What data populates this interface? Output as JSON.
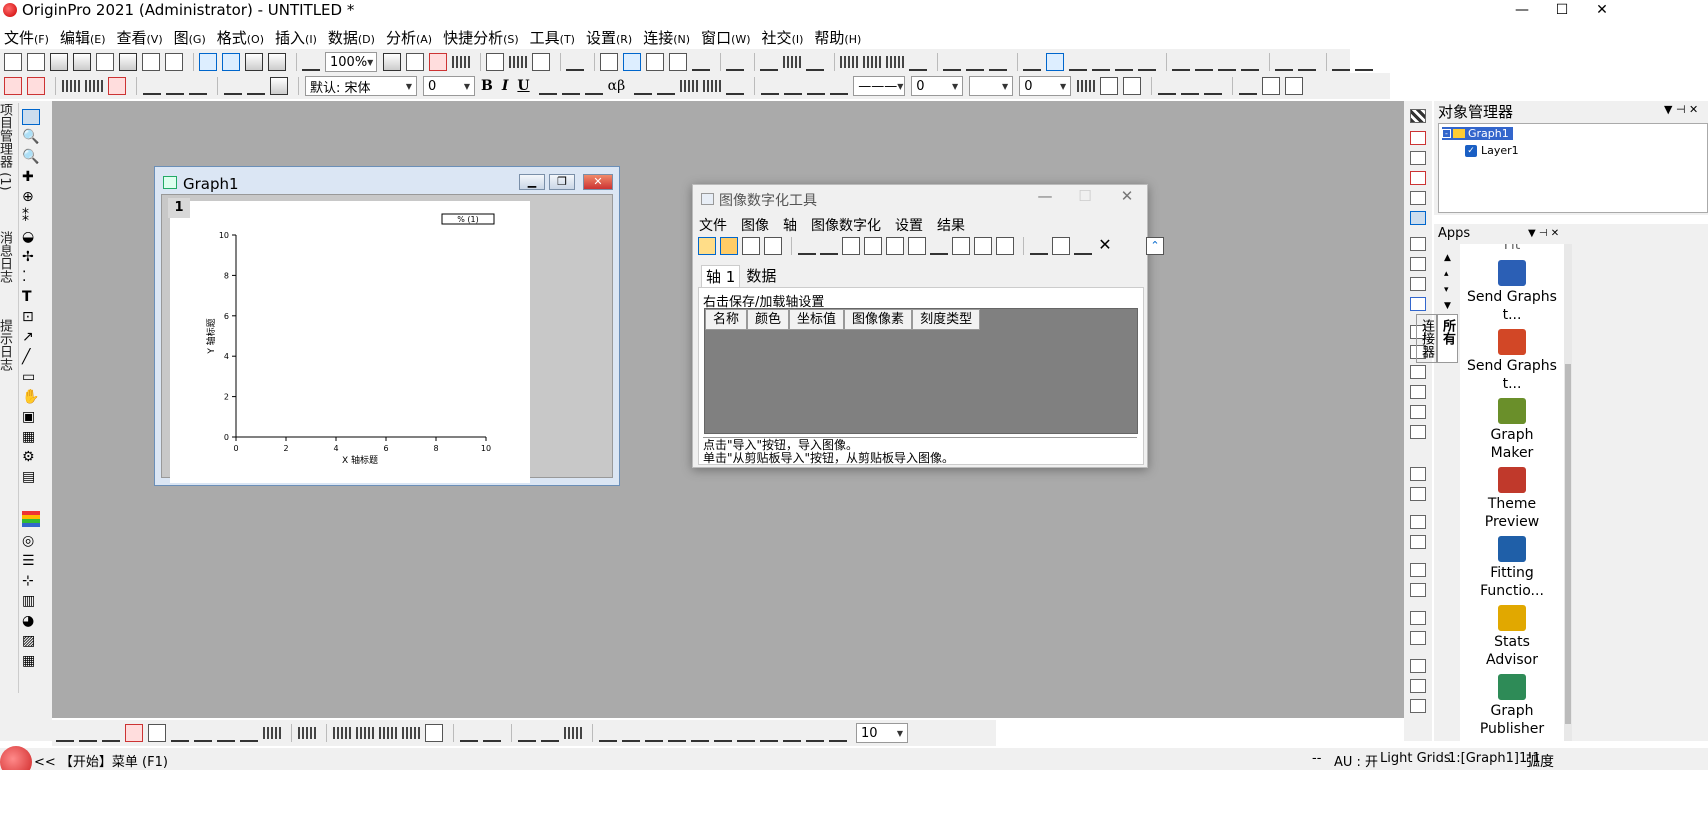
{
  "window": {
    "title": "OriginPro 2021 (Administrator) - UNTITLED *"
  },
  "menu": [
    {
      "label": "文件",
      "key": "(F)"
    },
    {
      "label": "编辑",
      "key": "(E)"
    },
    {
      "label": "查看",
      "key": "(V)"
    },
    {
      "label": "图",
      "key": "(G)"
    },
    {
      "label": "格式",
      "key": "(O)"
    },
    {
      "label": "插入",
      "key": "(I)"
    },
    {
      "label": "数据",
      "key": "(D)"
    },
    {
      "label": "分析",
      "key": "(A)"
    },
    {
      "label": "快捷分析",
      "key": "(S)"
    },
    {
      "label": "工具",
      "key": "(T)"
    },
    {
      "label": "设置",
      "key": "(R)"
    },
    {
      "label": "连接",
      "key": "(N)"
    },
    {
      "label": "窗口",
      "key": "(W)"
    },
    {
      "label": "社交",
      "key": "(I)"
    },
    {
      "label": "帮助",
      "key": "(H)"
    }
  ],
  "toolbar": {
    "zoom": "100%",
    "font": "默认: 宋体",
    "font_size": "0",
    "line_width": "0",
    "line_width2": "0",
    "bold": "B",
    "italic": "I",
    "underline": "U",
    "greek": "αβ"
  },
  "left_tabs": [
    "项目管理器 (1)",
    "消息日志",
    "提示日志"
  ],
  "graph_window": {
    "title": "Graph1",
    "layer_badge": "1",
    "legend_text": "% (1)",
    "xlabel": "X 轴标题",
    "ylabel": "Y 轴标题",
    "xticks": [
      "0",
      "2",
      "4",
      "6",
      "8",
      "10"
    ],
    "yticks": [
      "0",
      "2",
      "4",
      "6",
      "8",
      "10"
    ]
  },
  "digitizer": {
    "title": "图像数字化工具",
    "menu": [
      "文件",
      "图像",
      "轴",
      "图像数字化",
      "设置",
      "结果"
    ],
    "tabs": [
      "轴 1",
      "数据"
    ],
    "hint": "右击保存/加载轴设置",
    "columns": [
      "名称",
      "颜色",
      "坐标值",
      "图像像素",
      "刻度类型"
    ],
    "status_line1": "点击\"导入\"按钮，导入图像。",
    "status_line2": "单击\"从剪贴板导入\"按钮，从剪贴板导入图像。"
  },
  "object_manager": {
    "title": "对象管理器",
    "graph_node": "Graph1",
    "layer_node": "Layer1"
  },
  "apps": {
    "title": "Apps",
    "vertical_tabs": [
      "所有",
      "连接器"
    ],
    "partial_item": "Fit",
    "items": [
      {
        "name": "Send Graphs t...",
        "color": "#2b5fb5"
      },
      {
        "name": "Send Graphs t...",
        "color": "#d24726"
      },
      {
        "name": "Graph Maker",
        "color": "#6a8f2a"
      },
      {
        "name": "Theme Preview",
        "color": "#c0392b"
      },
      {
        "name": "Fitting Functio...",
        "color": "#1f5fa8"
      },
      {
        "name": "Stats Advisor",
        "color": "#e1a800"
      },
      {
        "name": "Graph Publisher",
        "color": "#2e8b57"
      }
    ]
  },
  "bottom_toolbar": {
    "size": "10"
  },
  "status": {
    "start": "<< 【开始】菜单 (F1)",
    "dashes": "--",
    "au": "AU : 开",
    "grid": "Light Grids",
    "layer": "1:[Graph1]1!1",
    "unit": "弧度"
  }
}
